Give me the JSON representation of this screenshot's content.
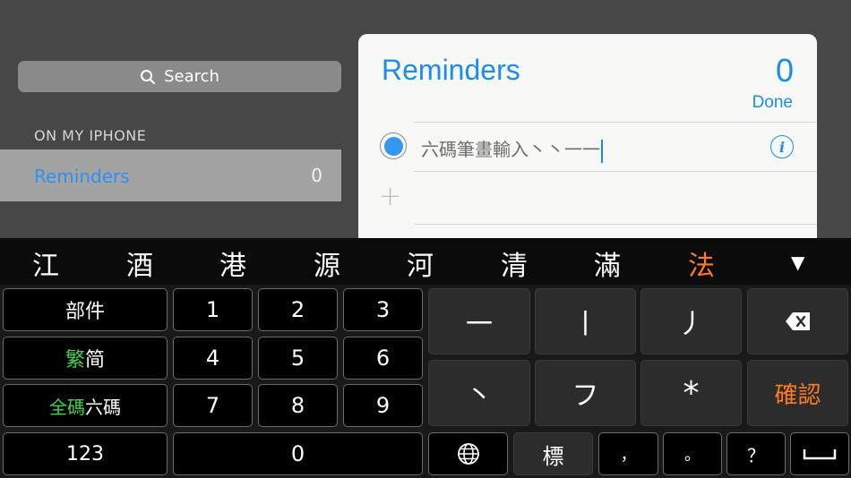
{
  "sidebar": {
    "search_label": "Search",
    "section_header": "ON MY IPHONE",
    "lists": [
      {
        "name": "Reminders",
        "count": "0"
      }
    ]
  },
  "card": {
    "title": "Reminders",
    "count": "0",
    "done_label": "Done",
    "entry_text": "六碼筆畫輸入丶丶一一"
  },
  "keyboard": {
    "candidates": [
      "江",
      "酒",
      "港",
      "源",
      "河",
      "清",
      "滿",
      "法"
    ],
    "candidate_highlight_index": 7,
    "more_candidates_icon": "triangle-down-icon",
    "keys": {
      "radicals": "部件",
      "trad": "繁",
      "simp": "简",
      "full_code": "全碼",
      "six_code": "六碼",
      "numbers_mode": "123",
      "d1": "1",
      "d2": "2",
      "d3": "3",
      "d4": "4",
      "d5": "5",
      "d6": "6",
      "d7": "7",
      "d8": "8",
      "d9": "9",
      "d0": "0",
      "s_heng": "一",
      "s_shu": "丨",
      "s_pie": "丿",
      "s_dian": "丶",
      "s_zhe": "フ",
      "s_star": "*",
      "confirm": "確認",
      "punct_mark": "標",
      "comma": "，",
      "period": "。",
      "question": "？"
    },
    "accent_green": "#3fd34a",
    "accent_orange": "#ff7a1e"
  },
  "colors": {
    "ios_blue": "#1b8cf1"
  }
}
